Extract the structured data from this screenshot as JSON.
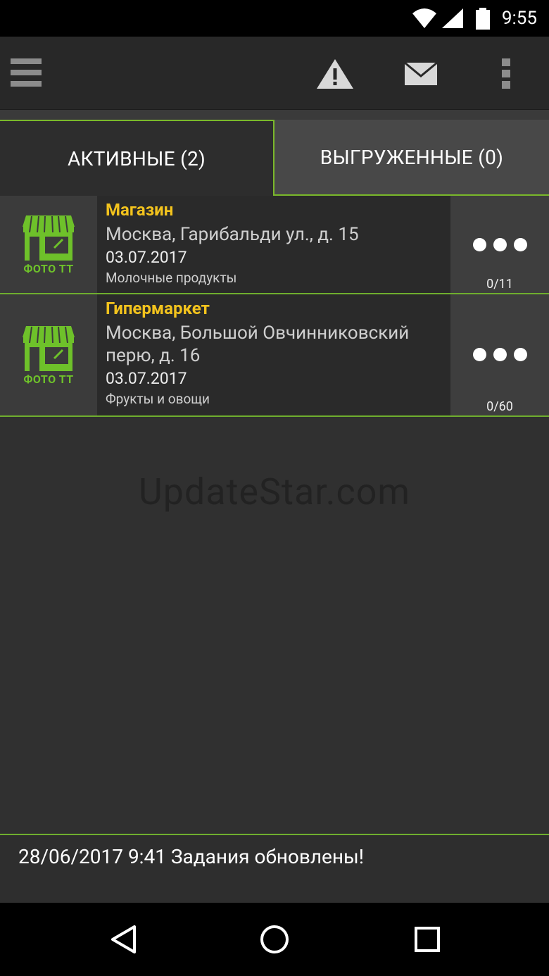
{
  "status_bar": {
    "time": "9:55"
  },
  "toolbar": {
    "menu_icon": "hamburger-menu-icon",
    "alert_icon": "warning-icon",
    "mail_icon": "envelope-icon",
    "overflow_icon": "overflow-menu-icon"
  },
  "tabs": [
    {
      "label": "АКТИВНЫЕ (2)",
      "active": true
    },
    {
      "label": "ВЫГРУЖЕННЫЕ (0)",
      "active": false
    }
  ],
  "tasks": [
    {
      "thumb_label": "ФОТО ТТ",
      "name": "Магазин",
      "address": "Москва, Гарибальди ул., д. 15",
      "date": "03.07.2017",
      "category": "Молочные продукты",
      "counter": "0/11"
    },
    {
      "thumb_label": "ФОТО ТТ",
      "name": "Гипермаркет",
      "address": "Москва, Большой Овчинниковский перю, д. 16",
      "date": "03.07.2017",
      "category": "Фрукты и овощи",
      "counter": "0/60"
    }
  ],
  "watermark": "UpdateStar.com",
  "footer": {
    "message": "28/06/2017 9:41 Задания обновлены!"
  },
  "colors": {
    "accent_green": "#6fae2e",
    "title_yellow": "#f3c31d",
    "icon_green": "#6ec12a"
  }
}
